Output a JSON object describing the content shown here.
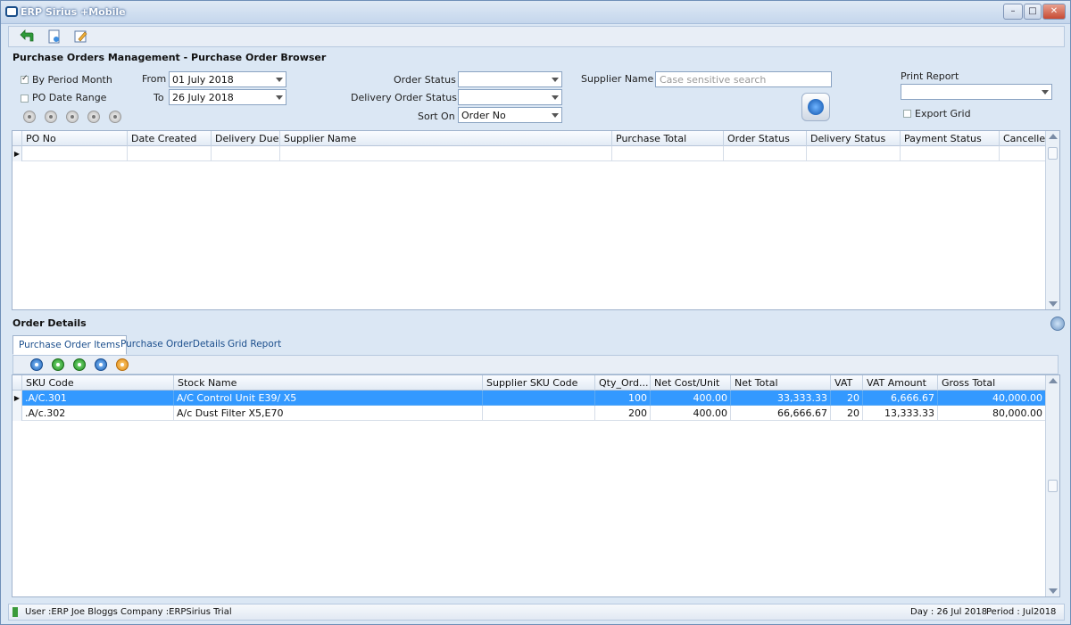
{
  "window": {
    "title": "ERP Sirius +Mobile",
    "minimize_label": "–",
    "maximize_label": "□",
    "close_label": "✕"
  },
  "toolbar": {
    "icons": [
      "back-arrow-icon",
      "new-document-icon",
      "edit-document-icon"
    ]
  },
  "browser": {
    "title": "Purchase Orders Management - Purchase Order Browser",
    "filters": {
      "by_period_month_label": "By Period Month",
      "by_period_month_checked": true,
      "po_date_range_label": "PO Date Range",
      "po_date_range_checked": false,
      "from_label": "From",
      "from_value": "01 July 2018",
      "to_label": "To",
      "to_value": "26 July 2018",
      "order_status_label": "Order Status",
      "order_status_value": "",
      "delivery_order_status_label": "Delivery Order Status",
      "delivery_order_status_value": "",
      "sort_on_label": "Sort On",
      "sort_on_value": "Order No",
      "supplier_name_label": "Supplier Name",
      "supplier_name_placeholder": "Case sensitive search",
      "print_report_label": "Print Report",
      "print_report_value": "",
      "export_grid_label": "Export Grid",
      "export_grid_checked": false
    },
    "grid": {
      "columns": [
        "PO No",
        "Date Created",
        "Delivery Due",
        "Supplier Name",
        "Purchase Total",
        "Order Status",
        "Delivery Status",
        "Payment Status",
        "Cancelled"
      ],
      "rows": []
    }
  },
  "details": {
    "title": "Order Details",
    "tabs": [
      {
        "label": "Purchase Order Items",
        "active": true
      },
      {
        "label": "Purchase OrderDetails",
        "active": false
      },
      {
        "label": "Grid Report",
        "active": false
      }
    ],
    "grid": {
      "columns": [
        "SKU Code",
        "Stock Name",
        "Supplier SKU Code",
        "Qty_Ord...",
        "Net Cost/Unit",
        "Net Total",
        "VAT",
        "VAT Amount",
        "Gross Total"
      ],
      "rows": [
        {
          "sku": ".A/C.301",
          "stock_name": "A/C Control Unit E39/ X5",
          "supplier_sku": "",
          "qty": "100",
          "net_cost": "400.00",
          "net_total": "33,333.33",
          "vat": "20",
          "vat_amount": "6,666.67",
          "gross_total": "40,000.00",
          "selected": true
        },
        {
          "sku": ".A/c.302",
          "stock_name": "A/c Dust Filter X5,E70",
          "supplier_sku": "",
          "qty": "200",
          "net_cost": "400.00",
          "net_total": "66,666.67",
          "vat": "20",
          "vat_amount": "13,333.33",
          "gross_total": "80,000.00",
          "selected": false
        }
      ]
    }
  },
  "status": {
    "user": "User :ERP Joe Bloggs",
    "company": "Company :ERPSirius Trial",
    "day": "Day : 26 Jul 2018",
    "period": "Period : Jul2018"
  },
  "colors": {
    "selection": "#3399ff",
    "background": "#dbe7f4",
    "link_blue": "#1b4e8c"
  }
}
